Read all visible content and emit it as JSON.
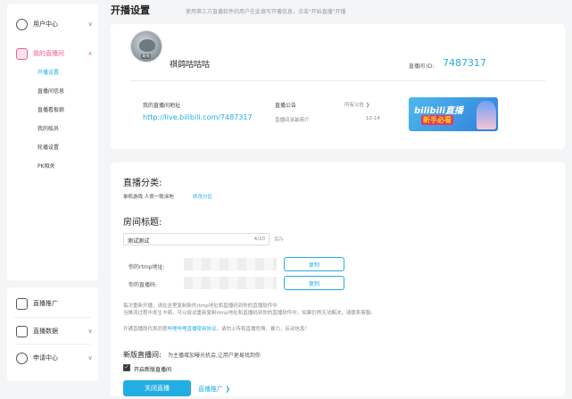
{
  "sidebar": {
    "user_center": "用户中心",
    "my_room": "我的直播间",
    "sub_items": [
      "开播设置",
      "直播间信息",
      "直播看板娘",
      "我的船员",
      "轮播设置",
      "PK相关"
    ],
    "promotion": "直播推广",
    "data": "直播数据",
    "apply_center": "申请中心"
  },
  "header": {
    "title": "开播设置",
    "subtitle": "使用第三方直播软件的用户在此填写开播信息，点击\"开始直播\"开播"
  },
  "profile": {
    "avatar_badge": "裁兔",
    "username": "祺鸽咕咕咕",
    "room_id_label": "直播间 ID:",
    "room_id": "7487317"
  },
  "address": {
    "label": "我的直播间地址",
    "url": "http://live.bilibili.com/7487317"
  },
  "announcement": {
    "label": "直播公告",
    "more": "所有公告",
    "item": "直播间涂装简介",
    "date": "12-14"
  },
  "banner": {
    "title": "bilibili直播",
    "subtitle": "新手必看"
  },
  "category": {
    "title": "直播分类:",
    "value": "单机游戏  人类一败涂地",
    "edit": "修改分区"
  },
  "room_title": {
    "title": "房间标题:",
    "value": "测试测试",
    "count": "4/20",
    "save": "保存"
  },
  "rtmp": {
    "address_label": "你的rtmp地址:",
    "code_label": "你的直播码:",
    "copy": "复制"
  },
  "notes": {
    "line1": "每次重新开播，请在这里复制新的rtmp地址和直播码到你的直播软件中",
    "line2": "当推流过程中发生卡顿，可以尝试重新复制rtmp地址和直播码到你的直播软件中，如果仍然无法解决，请联系客服。",
    "line3_prefix": "开通直播即代表同意",
    "line3_link": "哔哩哔哩直播使用协议",
    "line3_suffix": "，请勿上传和直播色情、暴力、反动信息！"
  },
  "new_room": {
    "title": "新版直播间:",
    "desc": "为主播增加曝光机会,让用户更易找到你",
    "checkbox_label": "开启新版直播间"
  },
  "actions": {
    "close_live": "关闭直播",
    "promote": "直播推广",
    "promote_arrow": "❯"
  },
  "icons": {
    "chevron_down": "∨",
    "chevron_up": "∧",
    "chevron_right": "❯",
    "check": "✓"
  },
  "colors": {
    "accent": "#23ade5",
    "active_nav": "#f25d8e"
  }
}
